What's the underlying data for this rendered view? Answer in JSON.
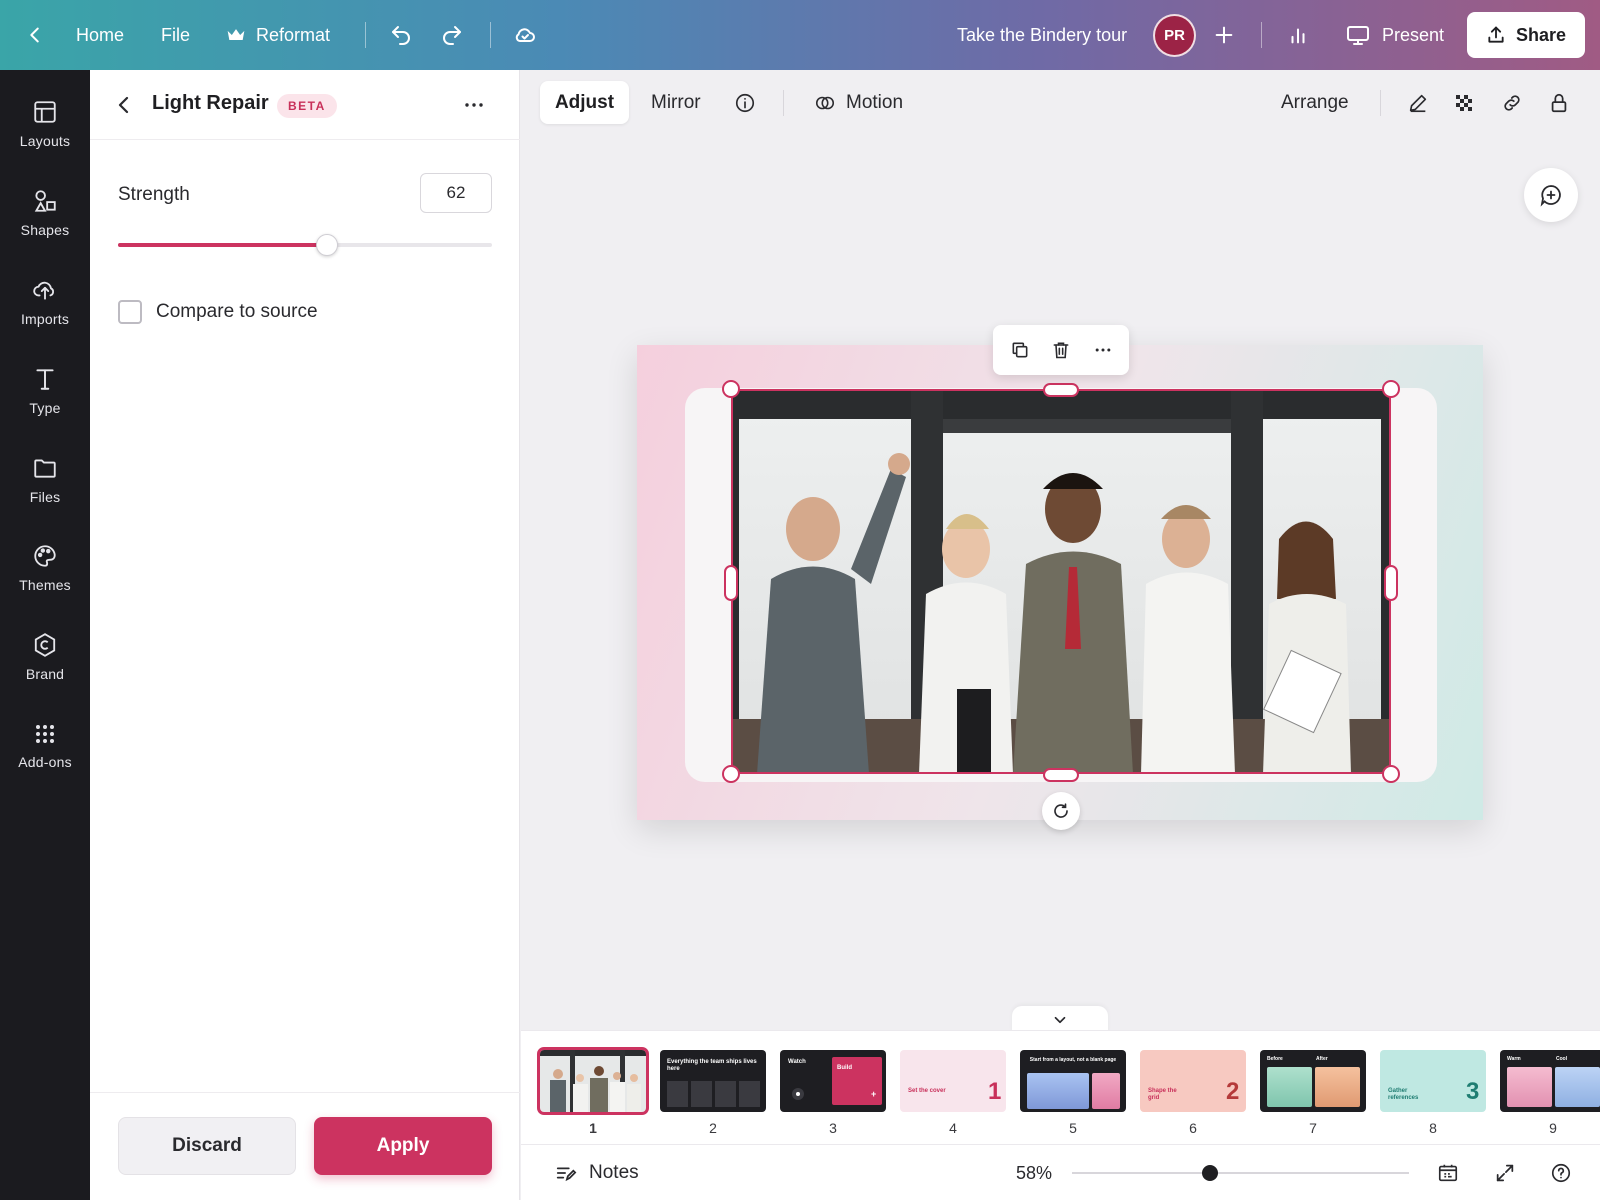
{
  "topbar": {
    "home": "Home",
    "file": "File",
    "reformat": "Reformat",
    "tour": "Take the Bindery tour",
    "avatar_initials": "PR",
    "present": "Present",
    "share": "Share",
    "gradient": [
      "#3aa5a8",
      "#4b8ab5",
      "#6f6aa6",
      "#a05b84"
    ]
  },
  "rail": {
    "items": [
      {
        "label": "Layouts",
        "icon": "layout-icon"
      },
      {
        "label": "Shapes",
        "icon": "shapes-icon"
      },
      {
        "label": "Imports",
        "icon": "upload-icon"
      },
      {
        "label": "Type",
        "icon": "type-icon"
      },
      {
        "label": "Files",
        "icon": "folder-icon"
      },
      {
        "label": "Themes",
        "icon": "palette-icon"
      },
      {
        "label": "Brand",
        "icon": "brand-icon"
      },
      {
        "label": "Add-ons",
        "icon": "grid-icon"
      }
    ]
  },
  "panel": {
    "title": "Light Repair",
    "badge": "BETA",
    "strength_label": "Strength",
    "strength_value": "62",
    "strength_fraction": 0.56,
    "compare_label": "Compare to source",
    "compare_checked": false,
    "discard": "Discard",
    "apply": "Apply"
  },
  "canvas_toolbar": {
    "adjust": "Adjust",
    "mirror": "Mirror",
    "motion": "Motion",
    "arrange": "Arrange"
  },
  "filmstrip": {
    "active_index": 1,
    "slides": [
      {
        "num": "1"
      },
      {
        "num": "2",
        "text": "Everything the team ships lives here"
      },
      {
        "num": "3",
        "text_a": "Watch",
        "text_b": "Build"
      },
      {
        "num": "4",
        "text": "Set the cover",
        "big": "1"
      },
      {
        "num": "5",
        "text": "Start from a layout, not a blank page"
      },
      {
        "num": "6",
        "text": "Shape the grid",
        "big": "2"
      },
      {
        "num": "7",
        "text_a": "Before",
        "text_b": "After"
      },
      {
        "num": "8",
        "text": "Gather references",
        "big": "3"
      },
      {
        "num": "9",
        "text_a": "Warm",
        "text_b": "Cool"
      }
    ]
  },
  "bottombar": {
    "notes": "Notes",
    "zoom": "58%",
    "zoom_fraction": 0.41
  },
  "colors": {
    "accent": "#cc3360",
    "rail_bg": "#1b1b1f"
  }
}
